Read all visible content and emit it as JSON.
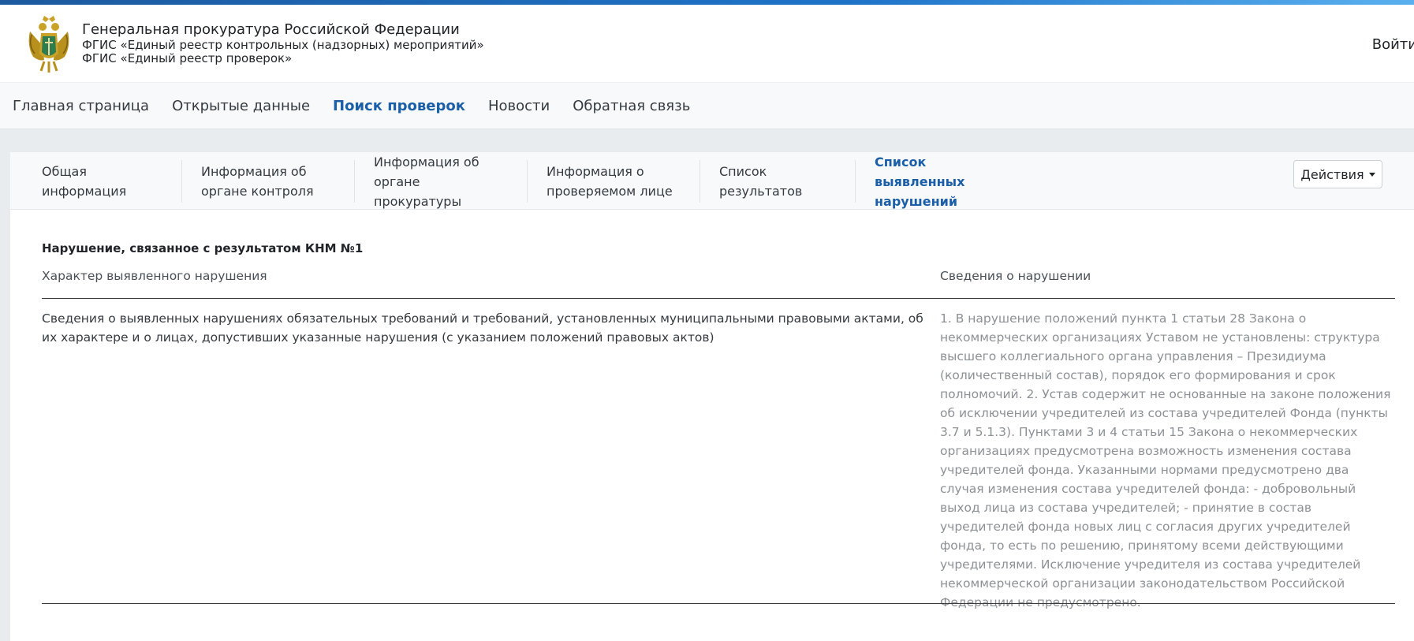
{
  "header": {
    "title": "Генеральная прокуратура Российской Федерации",
    "subtitle1": "ФГИС «Единый реестр контрольных (надзорных) мероприятий»",
    "subtitle2": "ФГИС «Единый реестр проверок»",
    "login": "Войти",
    "emblem_icon": "coat-of-arms-icon"
  },
  "nav": {
    "items": [
      {
        "label": "Главная страница"
      },
      {
        "label": "Открытые данные"
      },
      {
        "label": "Поиск проверок"
      },
      {
        "label": "Новости"
      },
      {
        "label": "Обратная связь"
      }
    ],
    "active": "Поиск проверок"
  },
  "tabs": {
    "items": [
      {
        "label": "Общая информация"
      },
      {
        "label": "Информация об органе контроля"
      },
      {
        "label": "Информация об органе прокуратуры"
      },
      {
        "label": "Информация о проверяемом лице"
      },
      {
        "label": "Список результатов"
      },
      {
        "label": "Список выявленных нарушений"
      }
    ],
    "active": "Список выявленных нарушений",
    "actions_label": "Действия"
  },
  "violation": {
    "title": "Нарушение, связанное с результатом КНМ №1",
    "col1_header": "Характер выявленного нарушения",
    "col2_header": "Сведения о нарушении",
    "character": "Сведения о выявленных нарушениях обязательных требований и требований, установленных муниципальными правовыми актами, об их характере и о лицах, допустивших указанные нарушения (с указанием положений правовых актов)",
    "details": "1. В нарушение положений пункта 1 статьи 28 Закона о некоммерческих организациях Уставом не установлены: структура высшего коллегиального органа управления – Президиума (количественный состав), порядок его формирования и срок полномочий. 2. Устав содержит не основанные на законе положения об исключении учредителей из состава учредителей Фонда (пункты 3.7 и 5.1.3). Пунктами 3 и 4 статьи 15 Закона о некоммерческих организациях предусмотрена возможность изменения состава учредителей фонда. Указанными нормами предусмотрено два случая изменения состава учредителей фонда: - добровольный выход лица из состава учредителей; - принятие в состав учредителей фонда новых лиц с согласия других учредителей фонда, то есть по решению, принятому всеми действующими учредителями. Исключение учредителя из состава учредителей некоммерческой организации законодательством Российской Федерации не предусмотрено."
  },
  "colors": {
    "accent": "#1a5fa8",
    "muted_text": "#8c9196",
    "page_bg": "#e9ecef"
  }
}
